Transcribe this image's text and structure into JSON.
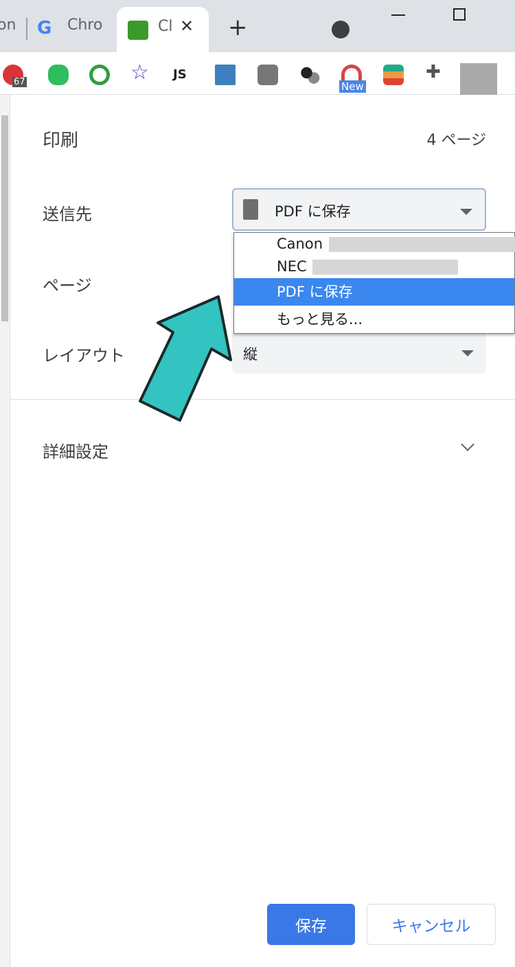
{
  "browser": {
    "tabs": [
      {
        "label": "on"
      },
      {
        "label": "Chro",
        "icon": "google-icon"
      },
      {
        "label": "Cl",
        "icon": "extension-page-icon",
        "active": true
      }
    ],
    "new_tab": "+",
    "extensions": [
      {
        "name": "adblock-icon",
        "badge": "67"
      },
      {
        "name": "evernote-icon"
      },
      {
        "name": "green-d-icon"
      },
      {
        "name": "star-icon"
      },
      {
        "name": "js-icon",
        "label": "JS"
      },
      {
        "name": "s-icon"
      },
      {
        "name": "line-icon"
      },
      {
        "name": "molecule-icon"
      },
      {
        "name": "rainbow-icon",
        "badge": "New"
      },
      {
        "name": "colorful-icon"
      },
      {
        "name": "puzzle-icon"
      }
    ]
  },
  "print": {
    "title": "印刷",
    "page_count": "4 ページ",
    "destination": {
      "label": "送信先",
      "value": "PDF に保存",
      "options": [
        "Canon",
        "NEC",
        "PDF に保存",
        "もっと見る..."
      ],
      "selected": 2
    },
    "pages": {
      "label": "ページ"
    },
    "layout": {
      "label": "レイアウト",
      "value": "縦"
    },
    "advanced": {
      "label": "詳細設定"
    },
    "save_button": "保存",
    "cancel_button": "キャンセル"
  },
  "colors": {
    "accent": "#3b87f0",
    "arrow": "#33c3c0"
  }
}
